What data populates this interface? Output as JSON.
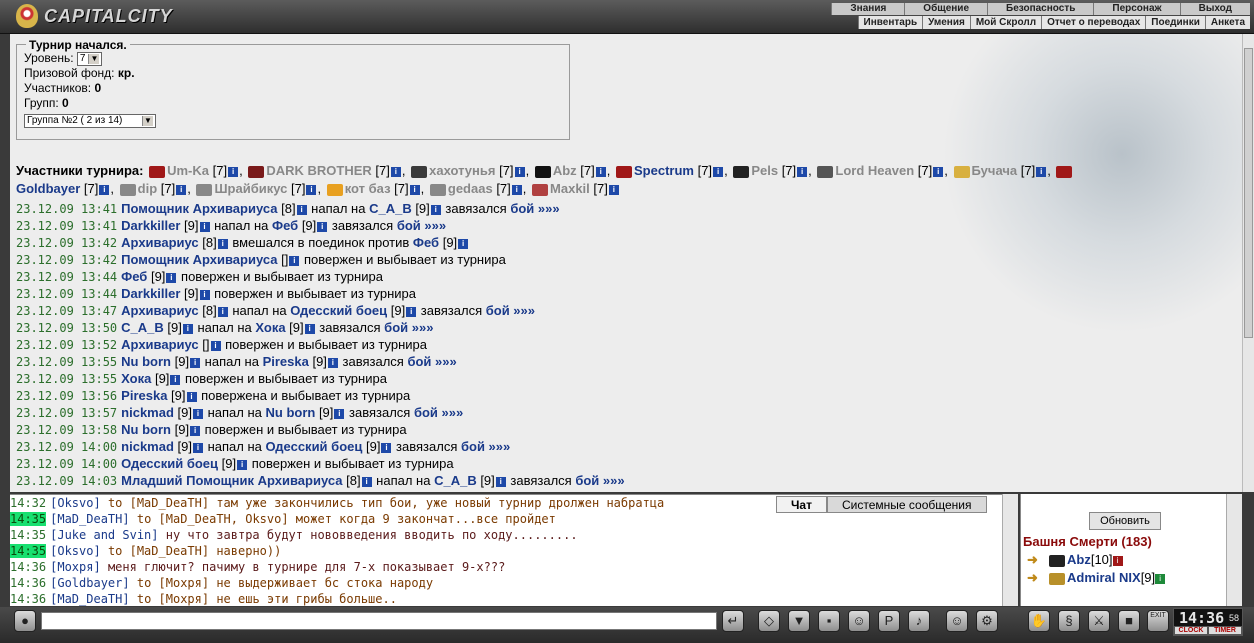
{
  "app": {
    "title": "CAPITALCITY"
  },
  "nav": {
    "main": [
      "Знания",
      "Общение",
      "Безопасность",
      "Персонаж",
      "Выход"
    ],
    "sub": [
      "Инвентарь",
      "Умения",
      "Мой Скролл",
      "Отчет о переводах",
      "Поединки",
      "Анкета"
    ]
  },
  "tournament": {
    "legend": "Турнир начался.",
    "level_label": "Уровень:",
    "level_value": "7",
    "prize_label": "Призовой фонд:",
    "prize_value": "кр.",
    "participants_label": "Участников:",
    "participants_value": "0",
    "groups_label": "Групп:",
    "groups_value": "0",
    "group_select": "Группа №2 ( 2 из 14)"
  },
  "participants": {
    "label": "Участники турнира:",
    "list": [
      {
        "name": "Um-Ka",
        "level": "[7]",
        "gray": true
      },
      {
        "name": "DARK BROTHER",
        "level": "[7]",
        "gray": true
      },
      {
        "name": "хахотунья",
        "level": "[7]",
        "gray": true
      },
      {
        "name": "Abz",
        "level": "[7]",
        "gray": true
      },
      {
        "name": "Spectrum",
        "level": "[7]",
        "gray": false
      },
      {
        "name": "Pels",
        "level": "[7]",
        "gray": true
      },
      {
        "name": "Lord Heaven",
        "level": "[7]",
        "gray": true
      },
      {
        "name": "Бучача",
        "level": "[7]",
        "gray": true
      },
      {
        "name": "Goldbayer",
        "level": "[7]",
        "gray": false
      },
      {
        "name": "dip",
        "level": "[7]",
        "gray": true
      },
      {
        "name": "Шрайбикус",
        "level": "[7]",
        "gray": true
      },
      {
        "name": "кот баз",
        "level": "[7]",
        "gray": true
      },
      {
        "name": "gedaas",
        "level": "[7]",
        "gray": true
      },
      {
        "name": "Maxkil",
        "level": "[7]",
        "gray": true
      }
    ]
  },
  "log": [
    {
      "time": "23.12.09 13:41",
      "parts": [
        [
          "n",
          "Помощник Архивариуса"
        ],
        [
          "x",
          " [8]"
        ],
        [
          "i",
          ""
        ],
        [
          "x",
          " напал на "
        ],
        [
          "n",
          "C_A_B"
        ],
        [
          "x",
          " [9]"
        ],
        [
          "i",
          ""
        ],
        [
          "x",
          " завязался "
        ],
        [
          "b",
          "бой »»»"
        ]
      ]
    },
    {
      "time": "23.12.09 13:41",
      "parts": [
        [
          "n",
          "Darkkiller"
        ],
        [
          "x",
          " [9]"
        ],
        [
          "i",
          ""
        ],
        [
          "x",
          " напал на "
        ],
        [
          "n",
          "Феб"
        ],
        [
          "x",
          " [9]"
        ],
        [
          "i",
          ""
        ],
        [
          "x",
          " завязался "
        ],
        [
          "b",
          "бой »»»"
        ]
      ]
    },
    {
      "time": "23.12.09 13:42",
      "parts": [
        [
          "n",
          "Архивариус"
        ],
        [
          "x",
          " [8]"
        ],
        [
          "i",
          ""
        ],
        [
          "x",
          " вмешался в поединок против "
        ],
        [
          "n",
          "Феб"
        ],
        [
          "x",
          " [9]"
        ],
        [
          "i",
          ""
        ]
      ]
    },
    {
      "time": "23.12.09 13:42",
      "parts": [
        [
          "n",
          "Помощник Архивариуса"
        ],
        [
          "x",
          " []"
        ],
        [
          "i",
          ""
        ],
        [
          "x",
          " повержен и выбывает из турнира"
        ]
      ]
    },
    {
      "time": "23.12.09 13:44",
      "parts": [
        [
          "n",
          "Феб"
        ],
        [
          "x",
          " [9]"
        ],
        [
          "i",
          ""
        ],
        [
          "x",
          " повержен и выбывает из турнира"
        ]
      ]
    },
    {
      "time": "23.12.09 13:44",
      "parts": [
        [
          "n",
          "Darkkiller"
        ],
        [
          "x",
          " [9]"
        ],
        [
          "i",
          ""
        ],
        [
          "x",
          " повержен и выбывает из турнира"
        ]
      ]
    },
    {
      "time": "23.12.09 13:47",
      "parts": [
        [
          "n",
          "Архивариус"
        ],
        [
          "x",
          " [8]"
        ],
        [
          "i",
          ""
        ],
        [
          "x",
          " напал на "
        ],
        [
          "n",
          "Одесский боец"
        ],
        [
          "x",
          " [9]"
        ],
        [
          "i",
          ""
        ],
        [
          "x",
          " завязался "
        ],
        [
          "b",
          "бой »»»"
        ]
      ]
    },
    {
      "time": "23.12.09 13:50",
      "parts": [
        [
          "n",
          "C_A_B"
        ],
        [
          "x",
          " [9]"
        ],
        [
          "i",
          ""
        ],
        [
          "x",
          " напал на "
        ],
        [
          "n",
          "Хока"
        ],
        [
          "x",
          " [9]"
        ],
        [
          "i",
          ""
        ],
        [
          "x",
          " завязался "
        ],
        [
          "b",
          "бой »»»"
        ]
      ]
    },
    {
      "time": "23.12.09 13:52",
      "parts": [
        [
          "n",
          "Архивариус"
        ],
        [
          "x",
          " []"
        ],
        [
          "i",
          ""
        ],
        [
          "x",
          " повержен и выбывает из турнира"
        ]
      ]
    },
    {
      "time": "23.12.09 13:55",
      "parts": [
        [
          "n",
          "Nu born"
        ],
        [
          "x",
          " [9]"
        ],
        [
          "i",
          ""
        ],
        [
          "x",
          " напал на "
        ],
        [
          "n",
          "Pireska"
        ],
        [
          "x",
          " [9]"
        ],
        [
          "i",
          ""
        ],
        [
          "x",
          " завязался "
        ],
        [
          "b",
          "бой »»»"
        ]
      ]
    },
    {
      "time": "23.12.09 13:55",
      "parts": [
        [
          "n",
          "Хока"
        ],
        [
          "x",
          " [9]"
        ],
        [
          "i",
          ""
        ],
        [
          "x",
          " повержен и выбывает из турнира"
        ]
      ]
    },
    {
      "time": "23.12.09 13:56",
      "parts": [
        [
          "n",
          "Pireska"
        ],
        [
          "x",
          " [9]"
        ],
        [
          "i",
          ""
        ],
        [
          "x",
          " повержена и выбывает из турнира"
        ]
      ]
    },
    {
      "time": "23.12.09 13:57",
      "parts": [
        [
          "n",
          "nickmad"
        ],
        [
          "x",
          " [9]"
        ],
        [
          "i",
          ""
        ],
        [
          "x",
          " напал на "
        ],
        [
          "n",
          "Nu born"
        ],
        [
          "x",
          " [9]"
        ],
        [
          "i",
          ""
        ],
        [
          "x",
          " завязался "
        ],
        [
          "b",
          "бой »»»"
        ]
      ]
    },
    {
      "time": "23.12.09 13:58",
      "parts": [
        [
          "n",
          "Nu born"
        ],
        [
          "x",
          " [9]"
        ],
        [
          "i",
          ""
        ],
        [
          "x",
          " повержен и выбывает из турнира"
        ]
      ]
    },
    {
      "time": "23.12.09 14:00",
      "parts": [
        [
          "n",
          "nickmad"
        ],
        [
          "x",
          " [9]"
        ],
        [
          "i",
          ""
        ],
        [
          "x",
          " напал на "
        ],
        [
          "n",
          "Одесский боец"
        ],
        [
          "x",
          " [9]"
        ],
        [
          "i",
          ""
        ],
        [
          "x",
          " завязался "
        ],
        [
          "b",
          "бой »»»"
        ]
      ]
    },
    {
      "time": "23.12.09 14:00",
      "parts": [
        [
          "n",
          "Одесский боец"
        ],
        [
          "x",
          " [9]"
        ],
        [
          "i",
          ""
        ],
        [
          "x",
          " повержен и выбывает из турнира"
        ]
      ]
    },
    {
      "time": "23.12.09 14:03",
      "parts": [
        [
          "n",
          "Младший Помощник Архивариуса"
        ],
        [
          "x",
          " [8]"
        ],
        [
          "i",
          ""
        ],
        [
          "x",
          " напал на "
        ],
        [
          "n",
          "C_A_B"
        ],
        [
          "x",
          " [9]"
        ],
        [
          "i",
          ""
        ],
        [
          "x",
          " завязался "
        ],
        [
          "b",
          "бой »»»"
        ]
      ]
    }
  ],
  "chat": {
    "tabs": [
      "Чат",
      "Системные сообщения"
    ],
    "lines": [
      {
        "time": "14:32",
        "hl": false,
        "author": "[Oksvo]",
        "to": "to [MaD_DeaTH]",
        "text": "там уже закончились тип бои, уже новый турнир дролжен набратца"
      },
      {
        "time": "14:35",
        "hl": true,
        "author": "[MaD_DeaTH]",
        "to": "to [MaD_DeaTH, Oksvo]",
        "text": "может когда 9 закончат...все пройдет"
      },
      {
        "time": "14:35",
        "hl": false,
        "author": "[Juke and Svin]",
        "to": "",
        "text": "ну что завтра будут нововведения вводить по ходу........."
      },
      {
        "time": "14:35",
        "hl": true,
        "author": "[Oksvo]",
        "to": "to [MaD_DeaTH]",
        "text": "наверно))"
      },
      {
        "time": "14:36",
        "hl": false,
        "author": "[Мохря]",
        "to": "",
        "text": "меня глючит? пачиму в турнире для 7-х показывает 9-х???"
      },
      {
        "time": "14:36",
        "hl": false,
        "author": "[Goldbayer]",
        "to": "to [Мохря]",
        "text": "не выдерживает бс стока народу"
      },
      {
        "time": "14:36",
        "hl": false,
        "author": "[MaD_DeaTH]",
        "to": "to [Мохря]",
        "text": "не ешь эти грибы больше.."
      }
    ]
  },
  "side": {
    "refresh": "Обновить",
    "tower": "Башня Смерти (183)",
    "users": [
      {
        "name": "Abz",
        "level": "[10]"
      },
      {
        "name": "Admiral NIX",
        "level": "[9]"
      }
    ]
  },
  "clock": {
    "time": "14:36",
    "seconds": "58",
    "label_clock": "CLOCK",
    "label_timer": "TIMER"
  },
  "toolbar": {
    "exit": "EXIT"
  }
}
